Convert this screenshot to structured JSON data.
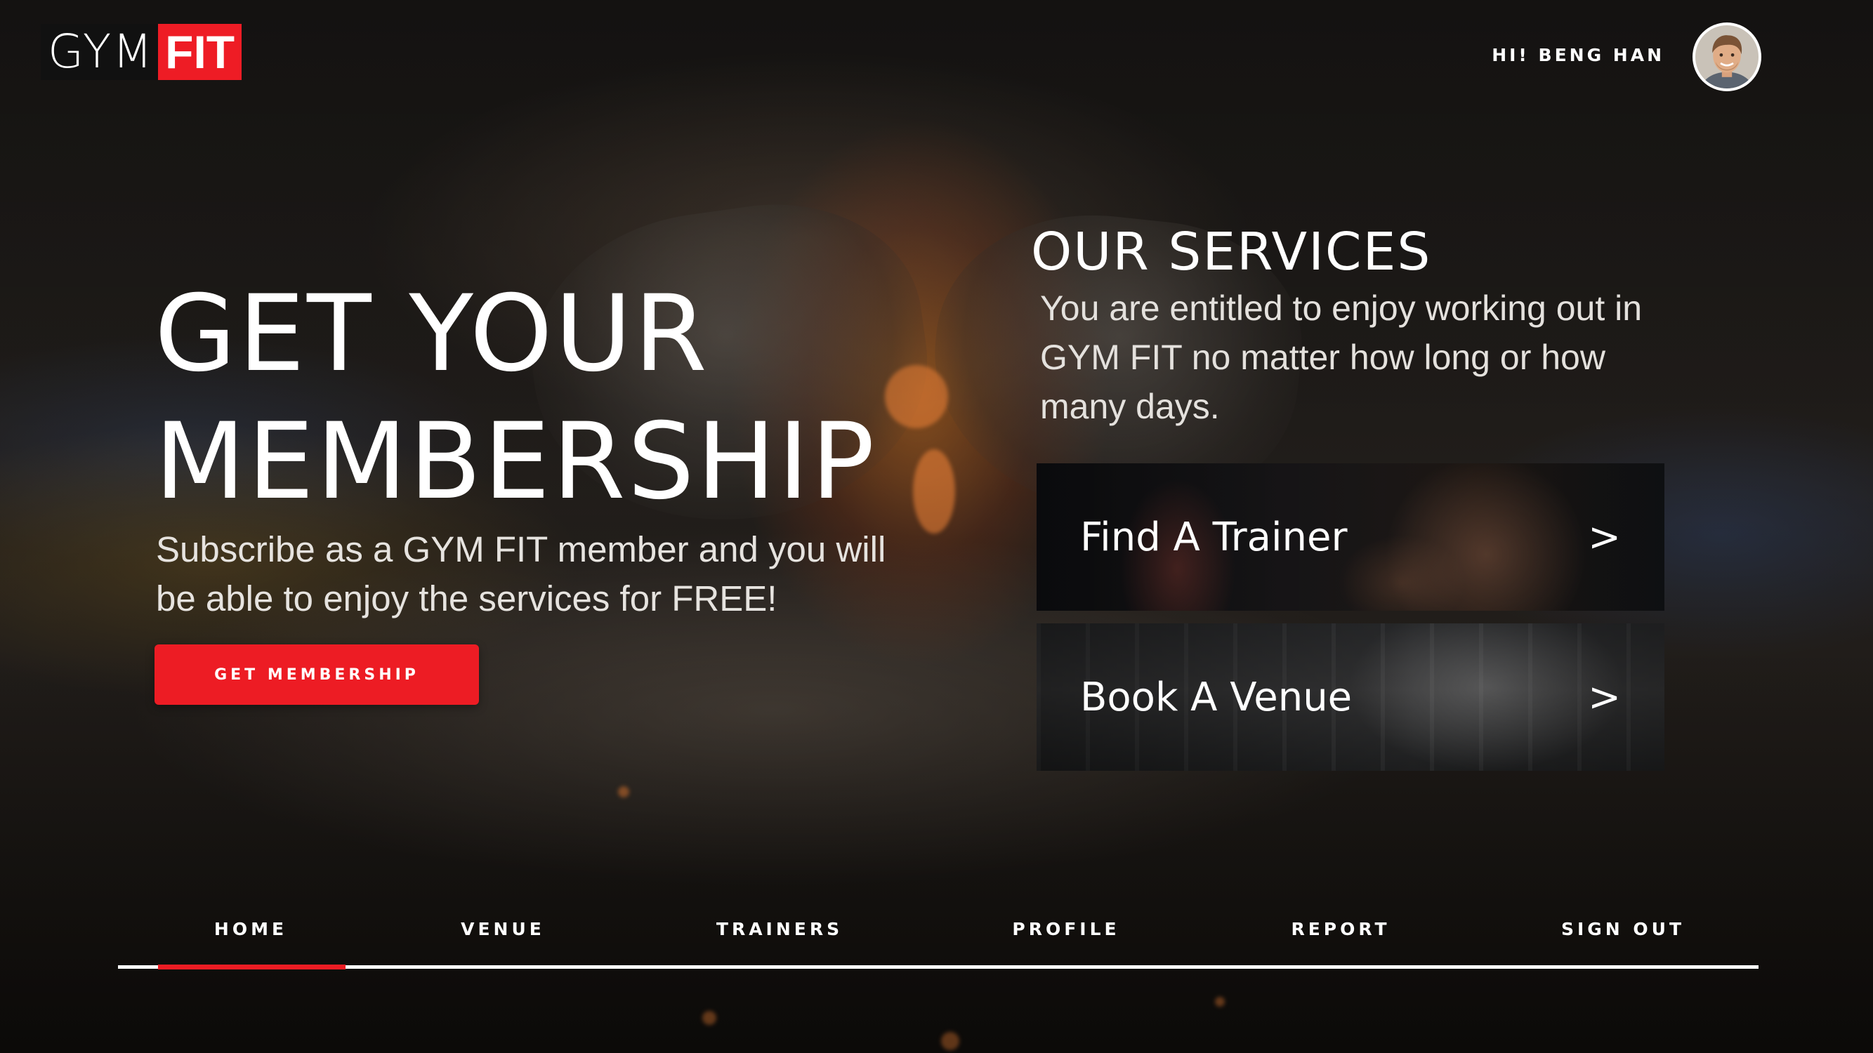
{
  "brand": {
    "logo_part1": "GYM",
    "logo_part2": "FIT",
    "accent_color": "#ed1c24"
  },
  "header": {
    "greeting": "HI! BENG HAN",
    "avatar_icon": "user-avatar-icon"
  },
  "hero": {
    "title_line1": "GET YOUR",
    "title_line2": "MEMBERSHIP",
    "subtitle": "Subscribe as a GYM FIT member and you will be able to enjoy the services for FREE!",
    "cta_label": "GET MEMBERSHIP"
  },
  "services": {
    "title": "OUR SERVICES",
    "description": "You are entitled to enjoy working out in GYM FIT no matter how long or how many days.",
    "cards": [
      {
        "label": "Find A Trainer",
        "arrow": ">"
      },
      {
        "label": "Book A Venue",
        "arrow": ">"
      }
    ]
  },
  "nav": {
    "items": [
      {
        "label": "HOME"
      },
      {
        "label": "VENUE"
      },
      {
        "label": "TRAINERS"
      },
      {
        "label": "PROFILE"
      },
      {
        "label": "REPORT"
      },
      {
        "label": "SIGN OUT"
      }
    ],
    "active": "HOME"
  }
}
